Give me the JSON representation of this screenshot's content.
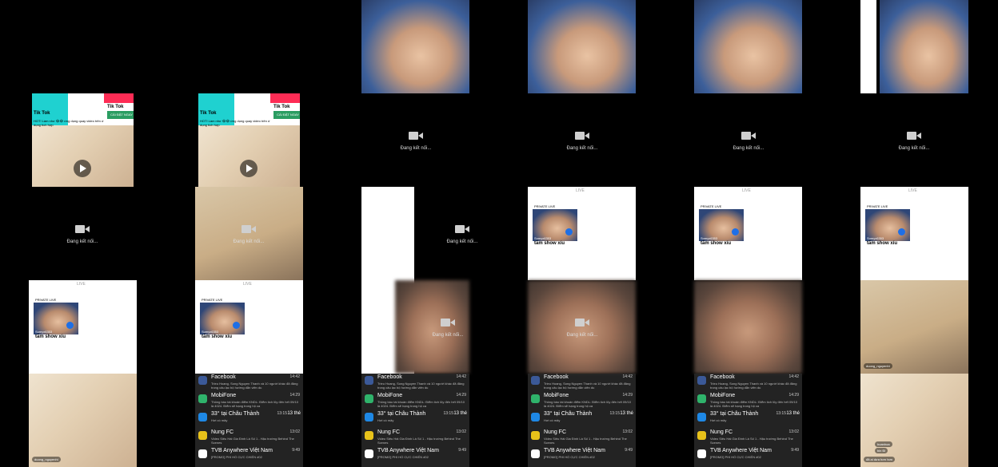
{
  "connecting_text": "Đang kết nối...",
  "ad": {
    "brand": "Tik Tok",
    "subtitle": "HOT! Làm như 😂😂 ứng dụng quay video trên ứ dụng tích hợp",
    "cta": "CÀI ĐẶT NGAY"
  },
  "live_card": {
    "tag": "PRIVATE LIVE",
    "user": "Sumyx6353",
    "title": "tắm show xíu"
  },
  "panel_header": "LIVE",
  "notifications": [
    {
      "app": "Facebook",
      "time": "14:42",
      "text": "Trieu Hoang, Song Nguyen Thanh và 10 người khác đã đăng trong câu lạc bộ hướng dẫn viên du",
      "color": "#3b5998",
      "icon": "facebook-icon"
    },
    {
      "app": "MobiFone",
      "time": "14:29",
      "text": "Thông báo tài khoản điểm KNDL: Điểm tích lũy đến hết 09/10 là 4024. Điểm sẽ hạng trong hộ ca",
      "color": "#2fb36b",
      "icon": "message-icon"
    },
    {
      "app": "33° tại Châu Thành",
      "time": "13:15",
      "extra": "13 thé",
      "text": "Hơi có mây",
      "color": "#1e88e5",
      "icon": "weather-icon"
    },
    {
      "app": "Nung FC",
      "time": "13:02",
      "text": "Video Siêu Hài Gia Đình Là Số 1 - Hậu trường Behind The Scenes",
      "color": "#e8c21a",
      "icon": "nung-fc-icon"
    },
    {
      "app": "TVB Anywhere Việt Nam",
      "time": "9:49",
      "text": "[PROMO] PHI HỔ CỰC CHIẾN #02",
      "color": "#ffffff",
      "icon": "tvb-icon"
    }
  ],
  "bottom_badge": "duong_nguyenhi",
  "comment": {
    "user": "hoanhoa",
    "text": "bin Đi"
  },
  "comment2": "đã ai dưa hơn hơn"
}
